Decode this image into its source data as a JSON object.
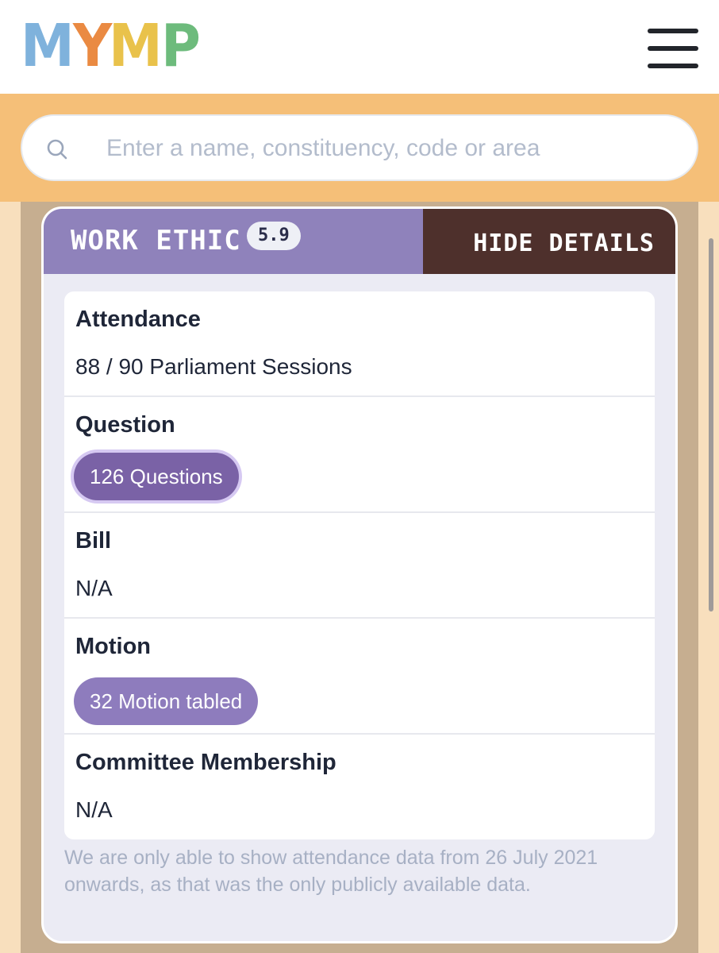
{
  "header": {
    "logo_letters": [
      {
        "char": "M",
        "color": "#7fb2dc"
      },
      {
        "char": "Y",
        "color": "#ea8a42"
      },
      {
        "char": "M",
        "color": "#e9c24b"
      },
      {
        "char": "P",
        "color": "#6dbb7c"
      }
    ]
  },
  "search": {
    "placeholder": "Enter a name, constituency, code or area",
    "value": ""
  },
  "card": {
    "title": "WORK ETHIC",
    "score": "5.9",
    "toggle_label": "HIDE DETAILS",
    "rows": [
      {
        "title": "Attendance",
        "value": "88 / 90 Parliament Sessions"
      },
      {
        "title": "Question",
        "pill": "126 Questions"
      },
      {
        "title": "Bill",
        "value": "N/A"
      },
      {
        "title": "Motion",
        "pill": "32 Motion tabled"
      },
      {
        "title": "Committee Membership",
        "value": "N/A"
      }
    ],
    "note": "We are only able to show attendance data from 26 July 2021 onwards, as that was the only publicly available data."
  },
  "colors": {
    "search_band": "#f5bf78",
    "card_header_left": "#8f82bb",
    "card_header_right": "#4e302c",
    "pill_active": "#7a62a6",
    "pill_plain": "#8e7cbd"
  }
}
